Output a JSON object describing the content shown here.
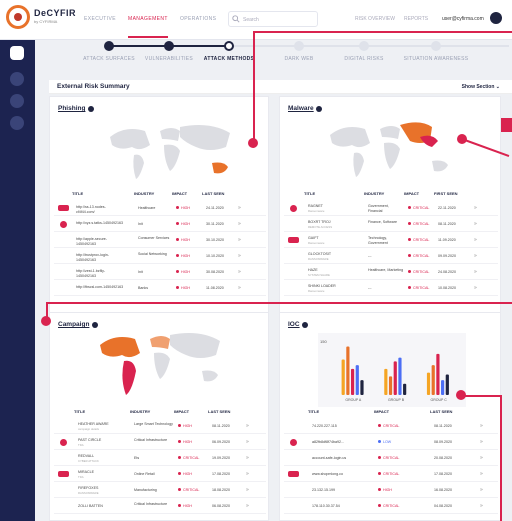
{
  "app": {
    "brand": "DeCYFIR",
    "brand_sub": "by CYFIRMA",
    "user_email": "user@cyfirma.com"
  },
  "nav": {
    "items": [
      "EXECUTIVE",
      "MANAGEMENT",
      "OPERATIONS"
    ],
    "active": "MANAGEMENT",
    "search_placeholder": "Search",
    "right_items": [
      "RISK OVERVIEW",
      "REPORTS"
    ]
  },
  "stepper": {
    "steps": [
      "ATTACK SURFACES",
      "VULNERABILITIES",
      "ATTACK METHODS",
      "DARK WEB",
      "DIGITAL RISKS",
      "SITUATION AWARENESS"
    ],
    "active": "ATTACK METHODS"
  },
  "summary": {
    "title": "External Risk Summary",
    "show_section": "Show Section"
  },
  "phishing": {
    "title": "Phishing",
    "headers": [
      "TITLE",
      "INDUSTRY",
      "IMPACT",
      "LAST SEEN"
    ],
    "rows": [
      {
        "title": "http://ss-13.nodes-cf4f44.com/",
        "sub": "",
        "industry": "Healthcare",
        "impact": "HIGH",
        "seen": "24.11.2020"
      },
      {
        "title": "http://xyz.s.tatks-1450492163",
        "sub": "",
        "industry": "Init",
        "impact": "HIGH",
        "seen": "30.11.2020"
      },
      {
        "title": "http://apple-secure-1450492163",
        "sub": "",
        "industry": "Consumer Services",
        "impact": "HIGH",
        "seen": "30.10.2020"
      },
      {
        "title": "http://trustprox-login-1450492163",
        "sub": "",
        "industry": "Social Networking",
        "impact": "HIGH",
        "seen": "10.10.2020"
      },
      {
        "title": "http://zest-1.bzfily-1450492163",
        "sub": "",
        "industry": "Init",
        "impact": "HIGH",
        "seen": "30.08.2020"
      },
      {
        "title": "http://fbscsl.com-1450492163",
        "sub": "",
        "industry": "Banks",
        "impact": "HIGH",
        "seen": "11.08.2020"
      }
    ]
  },
  "malware": {
    "title": "Malware",
    "headers": [
      "TITLE",
      "INDUSTRY",
      "IMPACT",
      "FIRST SEEN"
    ],
    "rows": [
      {
        "title": "RAGNET",
        "sub": "Ransomware",
        "industry": "Government, Financial",
        "impact": "CRITICAL",
        "seen": "22.11.2020"
      },
      {
        "title": "BOXRT TROJ",
        "sub": "REMOTE ACCESS",
        "industry": "Finance, Software",
        "impact": "CRITICAL",
        "seen": "08.11.2020"
      },
      {
        "title": "GAIFT",
        "sub": "Ransomware",
        "industry": "Technology, Government",
        "impact": "CRITICAL",
        "seen": "11.09.2020"
      },
      {
        "title": "GLOCKTOSIT",
        "sub": "RANSOMWARE",
        "industry": "---",
        "impact": "CRITICAL",
        "seen": "09.09.2020"
      },
      {
        "title": "HAZE",
        "sub": "SYSTEM SHARE",
        "industry": "Healthcare, Marketing",
        "impact": "CRITICAL",
        "seen": "24.08.2020"
      },
      {
        "title": "SHINKI LOADER",
        "sub": "Ransomware",
        "industry": "---",
        "impact": "CRITICAL",
        "seen": "10.08.2020"
      }
    ]
  },
  "campaign": {
    "title": "Campaign",
    "headers": [
      "TITLE",
      "INDUSTRY",
      "IMPACT",
      "LAST SEEN"
    ],
    "rows": [
      {
        "title": "HEATHER AWARE",
        "sub": "campaign details",
        "industry": "Large Smart Technology",
        "impact": "HIGH",
        "seen": "08.11.2020"
      },
      {
        "title": "PAST CIRCLE",
        "sub": "TDA",
        "industry": "Critical Infrastructure",
        "impact": "HIGH",
        "seen": "06.09.2020"
      },
      {
        "title": "REDVALL",
        "sub": "CYBER ATTACK",
        "industry": "Ets",
        "impact": "CRITICAL",
        "seen": "19.09.2020"
      },
      {
        "title": "MIRACLE",
        "sub": "TDA",
        "industry": "Online Retail",
        "impact": "HIGH",
        "seen": "17.08.2020"
      },
      {
        "title": "FIREFOXES",
        "sub": "RANSOMWARE",
        "industry": "Manufacturing",
        "impact": "CRITICAL",
        "seen": "18.08.2020"
      },
      {
        "title": "ZOLLI BATTEN",
        "sub": "",
        "industry": "Critical Infrastructure",
        "impact": "HIGH",
        "seen": "06.08.2020"
      }
    ]
  },
  "ioc": {
    "title": "IOC",
    "chart_data": {
      "type": "bar",
      "categories": [
        "GROUP A",
        "GROUP B",
        "GROUP C"
      ],
      "ylabel": "",
      "ylim": [
        0,
        150
      ],
      "ytick": "150",
      "series_colors": [
        "#f5a524",
        "#e8722a",
        "#d9234f",
        "#4c6ef5",
        "#1f2440"
      ],
      "series": [
        {
          "values": [
            95,
            70,
            60
          ]
        },
        {
          "values": [
            130,
            50,
            80
          ]
        },
        {
          "values": [
            70,
            90,
            110
          ]
        },
        {
          "values": [
            80,
            100,
            40
          ]
        },
        {
          "values": [
            40,
            30,
            55
          ]
        }
      ]
    },
    "headers": [
      "TITLE",
      "IMPACT",
      "LAST SEEN"
    ],
    "rows": [
      {
        "title": "74.220.227.115",
        "impact": "CRITICAL",
        "seen": "08.11.2020"
      },
      {
        "title": "a82fb8df8f74ba92...",
        "impact": "LOW",
        "seen": "08.09.2020"
      },
      {
        "title": "account-safe-login.us",
        "impact": "CRITICAL",
        "seen": "20.08.2020"
      },
      {
        "title": "www.shopmlong.co",
        "impact": "CRITICAL",
        "seen": "17.08.2020"
      },
      {
        "title": "23.132.15.199",
        "impact": "HIGH",
        "seen": "16.08.2020"
      },
      {
        "title": "178.110.30.37.54",
        "impact": "CRITICAL",
        "seen": "04.08.2020"
      }
    ]
  }
}
